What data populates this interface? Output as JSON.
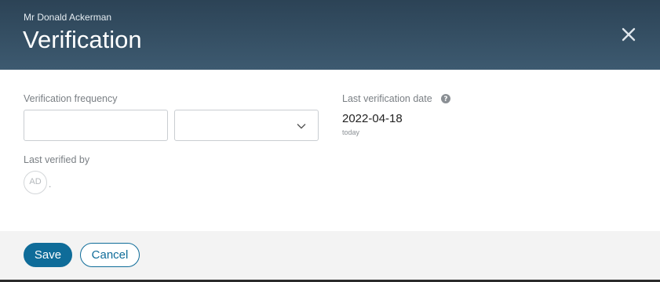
{
  "header": {
    "subtitle": "Mr Donald Ackerman",
    "title": "Verification",
    "close_icon": "close-icon"
  },
  "form": {
    "frequency_label": "Verification frequency",
    "frequency_value": "",
    "frequency_unit_value": "",
    "last_verification_date_label": "Last verification date",
    "last_verification_date_value": "2022-04-18",
    "last_verification_date_relative": "today",
    "last_verified_by_label": "Last verified by",
    "last_verified_by_initials": "AD",
    "last_verified_by_suffix": "."
  },
  "footer": {
    "save_label": "Save",
    "cancel_label": "Cancel"
  },
  "colors": {
    "header_bg": "#34506a",
    "accent": "#0f6c99",
    "footer_bg": "#f3f3f3"
  }
}
